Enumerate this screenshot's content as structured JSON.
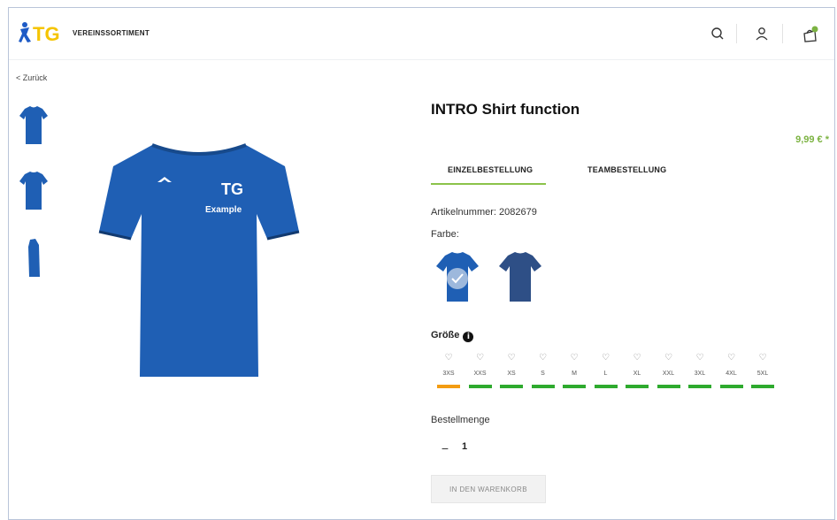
{
  "header": {
    "brand_name": "VEREINSSORTIMENT",
    "logo_text": "TG",
    "icons": [
      "search-icon",
      "user-icon",
      "cart-icon"
    ]
  },
  "nav": {
    "back_label": "< Zurück"
  },
  "product": {
    "title": "INTRO Shirt function",
    "price": "9,99 € *",
    "tabs": [
      {
        "label": "EINZELBESTELLUNG",
        "active": true
      },
      {
        "label": "TEAMBESTELLUNG",
        "active": false
      }
    ],
    "article_number": "Artikelnummer: 2082679",
    "color_label": "Farbe:",
    "colors": [
      {
        "name": "blue",
        "hex": "#1f5fb4",
        "selected": true
      },
      {
        "name": "navy",
        "hex": "#2e4f86",
        "selected": false
      }
    ],
    "size_label": "Größe",
    "sizes": [
      {
        "label": "3XS",
        "availability": "low"
      },
      {
        "label": "XXS",
        "availability": "available"
      },
      {
        "label": "XS",
        "availability": "available"
      },
      {
        "label": "S",
        "availability": "available"
      },
      {
        "label": "M",
        "availability": "available"
      },
      {
        "label": "L",
        "availability": "available"
      },
      {
        "label": "XL",
        "availability": "available"
      },
      {
        "label": "XXL",
        "availability": "available"
      },
      {
        "label": "3XL",
        "availability": "available"
      },
      {
        "label": "4XL",
        "availability": "available"
      },
      {
        "label": "5XL",
        "availability": "available"
      }
    ],
    "quantity_label": "Bestellmenge",
    "quantity_value": "1",
    "add_to_cart_label": "IN DEN WARENKORB",
    "shirt_print": "Example"
  },
  "colors": {
    "accent_green": "#8bc34a",
    "availability_low": "#f39c12",
    "availability_ok": "#2eaa2e",
    "shirt_blue": "#1f5fb4",
    "logo_yellow": "#f5c400",
    "logo_blue": "#1e5bc6"
  }
}
